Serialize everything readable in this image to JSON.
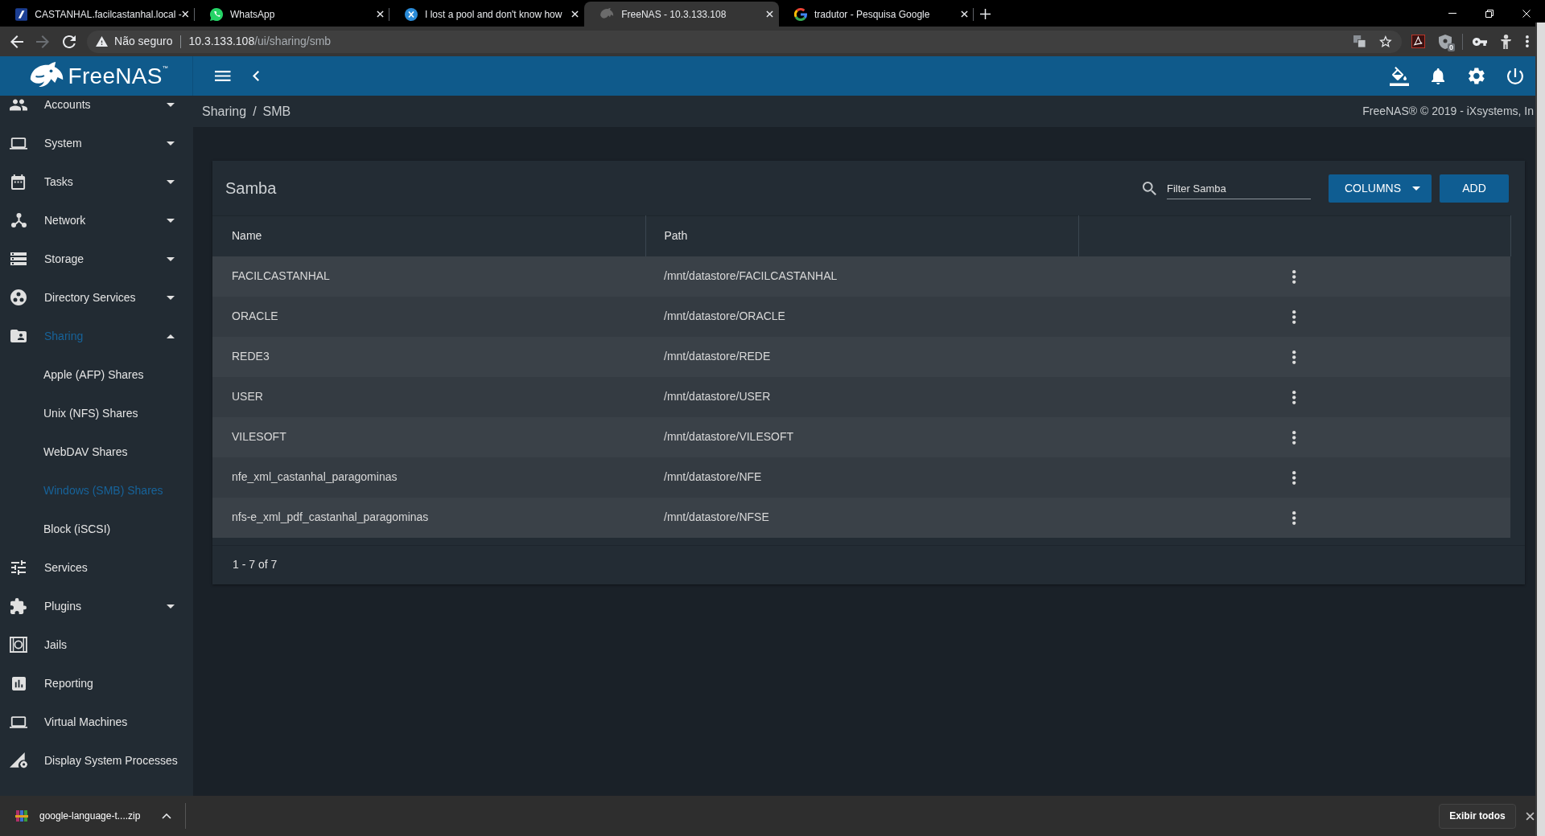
{
  "browser": {
    "tabs": [
      {
        "title": "CASTANHAL.facilcastanhal.local -",
        "selected": false
      },
      {
        "title": "WhatsApp",
        "selected": false
      },
      {
        "title": "I lost a pool and don't know how",
        "selected": false
      },
      {
        "title": "FreeNAS - 10.3.133.108",
        "selected": true
      },
      {
        "title": "tradutor - Pesquisa Google",
        "selected": false
      }
    ],
    "toolbar": {
      "forward_disabled": true,
      "security_label": "Não seguro",
      "url_host": "10.3.133.108",
      "url_path": "/ui/sharing/smb",
      "extension_badge": "0"
    }
  },
  "app_header": {
    "logo_text": "FreeNAS$^{™}$"
  },
  "sidebar": {
    "items": [
      {
        "label": "Accounts",
        "kind": "group",
        "expanded": false,
        "selected": false
      },
      {
        "label": "System",
        "kind": "group",
        "expanded": false,
        "selected": false
      },
      {
        "label": "Tasks",
        "kind": "group",
        "expanded": false,
        "selected": false
      },
      {
        "label": "Network",
        "kind": "group",
        "expanded": false,
        "selected": false
      },
      {
        "label": "Storage",
        "kind": "group",
        "expanded": false,
        "selected": false
      },
      {
        "label": "Directory Services",
        "kind": "group",
        "expanded": false,
        "selected": false
      },
      {
        "label": "Sharing",
        "kind": "group",
        "expanded": true,
        "selected": true,
        "children": [
          {
            "label": "Apple (AFP) Shares",
            "selected": false
          },
          {
            "label": "Unix (NFS) Shares",
            "selected": false
          },
          {
            "label": "WebDAV Shares",
            "selected": false
          },
          {
            "label": "Windows (SMB) Shares",
            "selected": true
          },
          {
            "label": "Block (iSCSI)",
            "selected": false
          }
        ]
      },
      {
        "label": "Services",
        "kind": "link",
        "selected": false
      },
      {
        "label": "Plugins",
        "kind": "group",
        "expanded": false,
        "selected": false
      },
      {
        "label": "Jails",
        "kind": "link",
        "selected": false
      },
      {
        "label": "Reporting",
        "kind": "link",
        "selected": false
      },
      {
        "label": "Virtual Machines",
        "kind": "link",
        "selected": false
      },
      {
        "label": "Display System Processes",
        "kind": "link",
        "selected": false
      }
    ]
  },
  "breadcrumb": {
    "items": [
      "Sharing",
      "SMB"
    ],
    "separator": "/"
  },
  "copyright": "FreeNAS® © 2019 - iXsystems, In",
  "card": {
    "title": "Samba",
    "filter": {
      "placeholder": "Filter Samba"
    },
    "buttons": [
      {
        "label": "COLUMNS",
        "kind": "dropdown"
      },
      {
        "label": "ADD",
        "kind": "plain"
      }
    ],
    "columns": [
      "Name",
      "Path"
    ],
    "rows": [
      {
        "name": "FACILCASTANHAL",
        "path": "/mnt/datastore/FACILCASTANHAL"
      },
      {
        "name": "ORACLE",
        "path": "/mnt/datastore/ORACLE"
      },
      {
        "name": "REDE3",
        "path": "/mnt/datastore/REDE"
      },
      {
        "name": "USER",
        "path": "/mnt/datastore/USER"
      },
      {
        "name": "VILESOFT",
        "path": "/mnt/datastore/VILESOFT"
      },
      {
        "name": "nfe_xml_castanhal_paragominas",
        "path": "/mnt/datastore/NFE"
      },
      {
        "name": "nfs-e_xml_pdf_castanhal_paragominas",
        "path": "/mnt/datastore/NFSE"
      }
    ],
    "footer": "1 - 7 of 7"
  },
  "downloads": {
    "items": [
      {
        "filename": "google-language-t....zip"
      }
    ],
    "show_all": "Exibir todos"
  }
}
